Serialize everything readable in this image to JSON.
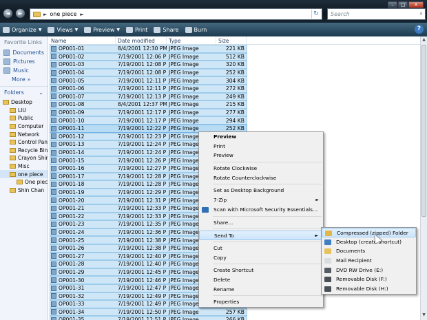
{
  "window": {
    "controls": [
      "–",
      "□",
      "✕"
    ]
  },
  "address": {
    "path": "one piece",
    "sep": "►"
  },
  "search": {
    "placeholder": "Search",
    "icon": "search-icon"
  },
  "toolbar": {
    "organize": "Organize",
    "views": "Views",
    "preview": "Preview",
    "print": "Print",
    "share": "Share",
    "burn": "Burn",
    "help": "?"
  },
  "nav": {
    "favorites_title": "Favorite Links",
    "favorites": [
      "Documents",
      "Pictures",
      "Music"
    ],
    "more": "More »",
    "folders_title": "Folders",
    "tree": [
      "Desktop",
      "LIU",
      "Public",
      "Computer",
      "Network",
      "Control Panel",
      "Recycle Bin",
      "Crayon Shin-chan",
      "Misc",
      "one piece",
      "One piece",
      "Shin Chan"
    ]
  },
  "columns": {
    "name": "Name",
    "date": "Date modified",
    "type": "Type",
    "size": "Size"
  },
  "files": [
    {
      "name": "OP001-01",
      "date": "8/4/2001 12:30 PM",
      "type": "JPEG Image",
      "size": "221 KB"
    },
    {
      "name": "OP001-02",
      "date": "7/19/2001 12:06 PM",
      "type": "JPEG Image",
      "size": "512 KB"
    },
    {
      "name": "OP001-03",
      "date": "7/19/2001 12:08 PM",
      "type": "JPEG Image",
      "size": "320 KB"
    },
    {
      "name": "OP001-04",
      "date": "7/19/2001 12:08 PM",
      "type": "JPEG Image",
      "size": "252 KB"
    },
    {
      "name": "OP001-05",
      "date": "7/19/2001 12:11 PM",
      "type": "JPEG Image",
      "size": "304 KB"
    },
    {
      "name": "OP001-06",
      "date": "7/19/2001 12:11 PM",
      "type": "JPEG Image",
      "size": "272 KB"
    },
    {
      "name": "OP001-07",
      "date": "7/19/2001 12:13 PM",
      "type": "JPEG Image",
      "size": "249 KB"
    },
    {
      "name": "OP001-08",
      "date": "8/4/2001 12:37 PM",
      "type": "JPEG Image",
      "size": "215 KB"
    },
    {
      "name": "OP001-09",
      "date": "7/19/2001 12:17 PM",
      "type": "JPEG Image",
      "size": "277 KB"
    },
    {
      "name": "OP001-10",
      "date": "7/19/2001 12:17 PM",
      "type": "JPEG Image",
      "size": "294 KB"
    },
    {
      "name": "OP001-11",
      "date": "7/19/2001 12:22 PM",
      "type": "JPEG Image",
      "size": "252 KB"
    },
    {
      "name": "OP001-12",
      "date": "7/19/2001 12:23 PM",
      "type": "JPEG Image",
      "size": ""
    },
    {
      "name": "OP001-13",
      "date": "7/19/2001 12:24 PM",
      "type": "JPEG Image",
      "size": ""
    },
    {
      "name": "OP001-14",
      "date": "7/19/2001 12:24 PM",
      "type": "JPEG Image",
      "size": ""
    },
    {
      "name": "OP001-15",
      "date": "7/19/2001 12:26 PM",
      "type": "JPEG Image",
      "size": ""
    },
    {
      "name": "OP001-16",
      "date": "7/19/2001 12:27 PM",
      "type": "JPEG Image",
      "size": ""
    },
    {
      "name": "OP001-17",
      "date": "7/19/2001 12:28 PM",
      "type": "JPEG Image",
      "size": ""
    },
    {
      "name": "OP001-18",
      "date": "7/19/2001 12:28 PM",
      "type": "JPEG Image",
      "size": ""
    },
    {
      "name": "OP001-19",
      "date": "7/19/2001 12:29 PM",
      "type": "JPEG Image",
      "size": ""
    },
    {
      "name": "OP001-20",
      "date": "7/19/2001 12:31 PM",
      "type": "JPEG Image",
      "size": ""
    },
    {
      "name": "OP001-21",
      "date": "7/19/2001 12:33 PM",
      "type": "JPEG Image",
      "size": ""
    },
    {
      "name": "OP001-22",
      "date": "7/19/2001 12:33 PM",
      "type": "JPEG Image",
      "size": ""
    },
    {
      "name": "OP001-23",
      "date": "7/19/2001 12:35 PM",
      "type": "JPEG Image",
      "size": ""
    },
    {
      "name": "OP001-24",
      "date": "7/19/2001 12:36 PM",
      "type": "JPEG Image",
      "size": ""
    },
    {
      "name": "OP001-25",
      "date": "7/19/2001 12:38 PM",
      "type": "JPEG Image",
      "size": ""
    },
    {
      "name": "OP001-26",
      "date": "7/19/2001 12:38 PM",
      "type": "JPEG Image",
      "size": ""
    },
    {
      "name": "OP001-27",
      "date": "7/19/2001 12:40 PM",
      "type": "JPEG Image",
      "size": ""
    },
    {
      "name": "OP001-28",
      "date": "7/19/2001 12:40 PM",
      "type": "JPEG Image",
      "size": ""
    },
    {
      "name": "OP001-29",
      "date": "7/19/2001 12:45 PM",
      "type": "JPEG Image",
      "size": ""
    },
    {
      "name": "OP001-30",
      "date": "7/19/2001 12:46 PM",
      "type": "JPEG Image",
      "size": ""
    },
    {
      "name": "OP001-31",
      "date": "7/19/2001 12:47 PM",
      "type": "JPEG Image",
      "size": ""
    },
    {
      "name": "OP001-32",
      "date": "7/19/2001 12:49 PM",
      "type": "JPEG Image",
      "size": ""
    },
    {
      "name": "OP001-33",
      "date": "7/19/2001 12:49 PM",
      "type": "JPEG Image",
      "size": "257 KB"
    },
    {
      "name": "OP001-34",
      "date": "7/19/2001 12:50 PM",
      "type": "JPEG Image",
      "size": "257 KB"
    },
    {
      "name": "OP001-35",
      "date": "7/19/2001 12:51 PM",
      "type": "JPEG Image",
      "size": "266 KB"
    }
  ],
  "context_menu": [
    {
      "label": "Preview",
      "bold": true
    },
    {
      "label": "Print"
    },
    {
      "label": "Preview"
    },
    {
      "sep": true
    },
    {
      "label": "Rotate Clockwise"
    },
    {
      "label": "Rotate Counterclockwise"
    },
    {
      "sep": true
    },
    {
      "label": "Set as Desktop Background"
    },
    {
      "label": "7-Zip",
      "submenu": true
    },
    {
      "label": "Scan with Microsoft Security Essentials...",
      "icon": "shield-icon"
    },
    {
      "sep": true
    },
    {
      "label": "Share..."
    },
    {
      "sep": true
    },
    {
      "label": "Send To",
      "submenu": true,
      "highlight": true
    },
    {
      "sep": true
    },
    {
      "label": "Cut"
    },
    {
      "label": "Copy"
    },
    {
      "sep": true
    },
    {
      "label": "Create Shortcut"
    },
    {
      "label": "Delete"
    },
    {
      "label": "Rename"
    },
    {
      "sep": true
    },
    {
      "label": "Properties"
    }
  ],
  "sendto_menu": [
    {
      "label": "Compressed (zipped) Folder",
      "icon": "zip-folder-icon",
      "color": "#e3b64a",
      "highlight": true
    },
    {
      "label": "Desktop (create shortcut)",
      "icon": "desktop-icon",
      "color": "#3f7fc4"
    },
    {
      "label": "Documents",
      "icon": "documents-icon",
      "color": "#e8c25a"
    },
    {
      "label": "Mail Recipient",
      "icon": "mail-icon",
      "color": "#d9dde2"
    },
    {
      "label": "DVD RW Drive (E:)",
      "icon": "dvd-drive-icon",
      "color": "#555b62"
    },
    {
      "label": "Removable Disk (F:)",
      "icon": "removable-disk-icon",
      "color": "#4a4f55"
    },
    {
      "label": "Removable Disk (H:)",
      "icon": "removable-disk-icon",
      "color": "#4a4f55"
    }
  ]
}
